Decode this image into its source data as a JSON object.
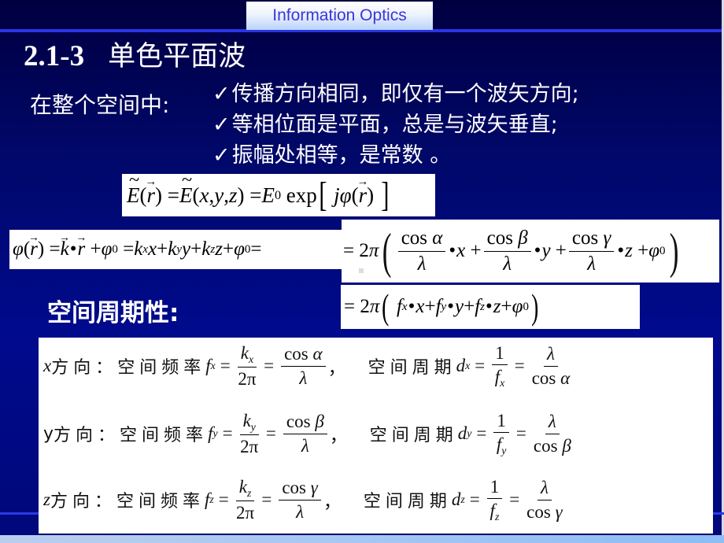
{
  "header": {
    "course_title": "Information Optics"
  },
  "slide": {
    "section_number": "2.1-3",
    "section_title": "单色平面波",
    "scope_label": "在整个空间中:",
    "bullets": [
      {
        "icon": "check-icon",
        "text": "传播方向相同，即仅有一个波矢方向;"
      },
      {
        "icon": "check-icon",
        "text": "等相位面是平面，总是与波矢垂直;"
      },
      {
        "icon": "check-icon",
        "text": "振幅处相等，是常数 。"
      }
    ],
    "equations": {
      "field": "Ẽ(r⃗) = Ẽ(x, y, z) = E₀ exp[ jφ(r⃗) ]",
      "phase_linear": "φ(r⃗) = k⃗•r⃗ + φ₀ = kₓx + k_y y + k_z z + φ₀ =",
      "phase_direction_cosines": "2π( (cos α / λ)•x + (cos β / λ)•y + (cos γ / λ)•z + φ₀ )",
      "phase_spatial_freq": "= 2π( fₓ•x + f_y•y + f_z•z + φ₀ )"
    },
    "periodicity_label": "空间周期性:",
    "table": {
      "freq_label": "空间频率",
      "period_label": "空间周期",
      "rows": [
        {
          "axis": "x",
          "dir_label": "方向：",
          "f": "f",
          "sub": "x",
          "k": "k",
          "angle": "α",
          "d": "d",
          "one": "1",
          "two_pi": "2π",
          "cos": "cos",
          "lambda": "λ",
          "comma": "，"
        },
        {
          "axis": "y",
          "dir_label": "方向：",
          "f": "f",
          "sub": "y",
          "k": "k",
          "angle": "β",
          "d": "d",
          "one": "1",
          "two_pi": "2π",
          "cos": "cos",
          "lambda": "λ",
          "comma": "，"
        },
        {
          "axis": "z",
          "dir_label": "方向：",
          "f": "f",
          "sub": "z",
          "k": "k",
          "angle": "γ",
          "d": "d",
          "one": "1",
          "two_pi": "2π",
          "cos": "cos",
          "lambda": "λ",
          "comma": "，"
        }
      ]
    }
  },
  "colors": {
    "background": "#000a8c",
    "header_text": "#3a36d8",
    "accent_rule": "#2a34e6",
    "text_light": "#ffffff"
  }
}
